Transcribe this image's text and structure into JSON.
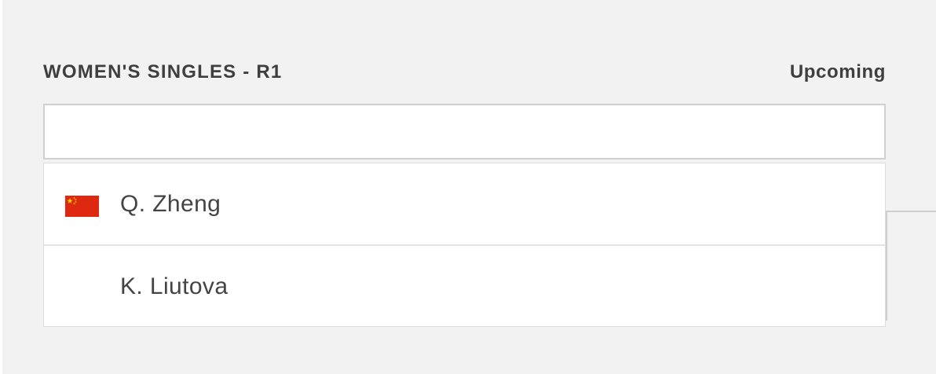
{
  "match": {
    "round_title": "WOMEN'S SINGLES - R1",
    "status": "Upcoming",
    "info": "",
    "players": [
      {
        "name": "Q. Zheng",
        "flag": "china-flag-icon"
      },
      {
        "name": "K. Liutova",
        "flag": ""
      }
    ]
  },
  "colors": {
    "background": "#f2f2f2",
    "card": "#ffffff",
    "text": "#444444",
    "border": "#cfcfcf",
    "flag_red": "#de2910",
    "flag_yellow": "#ffde00"
  }
}
